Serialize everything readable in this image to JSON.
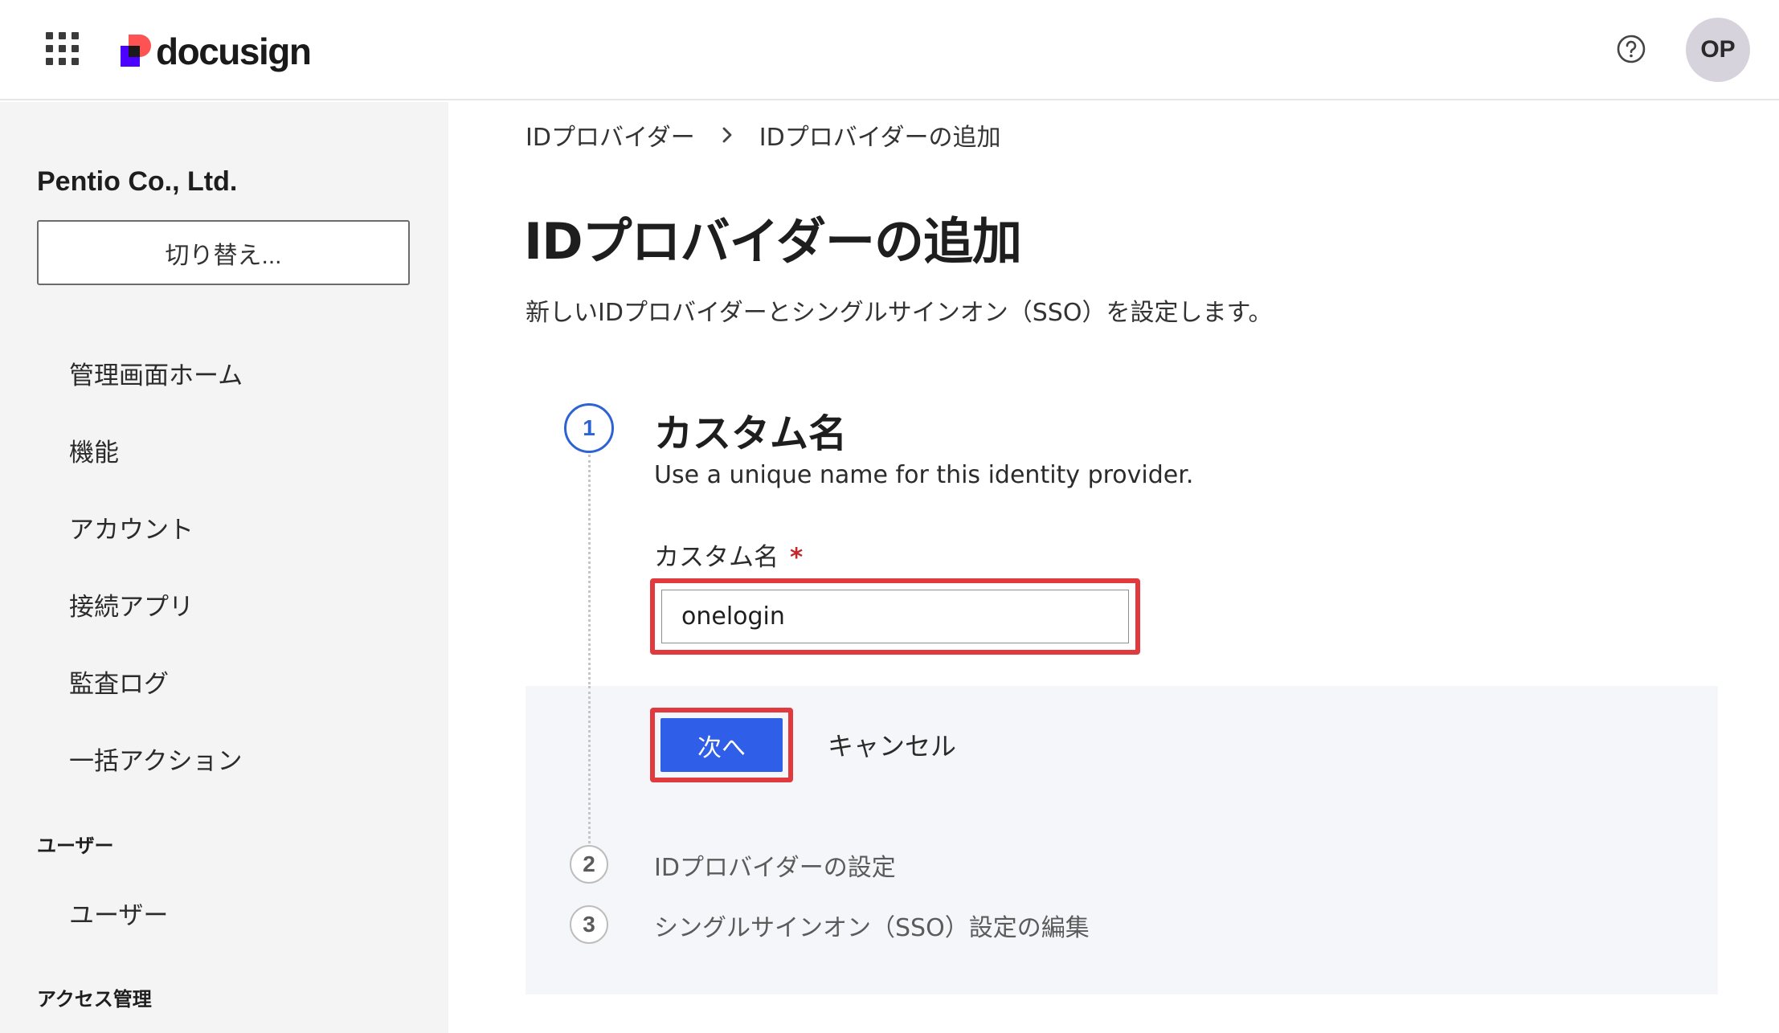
{
  "header": {
    "logo_text": "docusign",
    "avatar_initials": "OP"
  },
  "sidebar": {
    "org_name": "Pentio Co., Ltd.",
    "switch_label": "切り替え...",
    "items": [
      {
        "label": "管理画面ホーム"
      },
      {
        "label": "機能"
      },
      {
        "label": "アカウント"
      },
      {
        "label": "接続アプリ"
      },
      {
        "label": "監査ログ"
      },
      {
        "label": "一括アクション"
      }
    ],
    "section_users": "ユーザー",
    "users_item": "ユーザー",
    "section_access": "アクセス管理"
  },
  "breadcrumb": {
    "parent": "IDプロバイダー",
    "current": "IDプロバイダーの追加"
  },
  "page": {
    "title": "IDプロバイダーの追加",
    "description": "新しいIDプロバイダーとシングルサインオン（SSO）を設定します。"
  },
  "steps": [
    {
      "number": "1",
      "title": "カスタム名",
      "subtitle": "Use a unique name for this identity provider."
    },
    {
      "number": "2",
      "title": "IDプロバイダーの設定"
    },
    {
      "number": "3",
      "title": "シングルサインオン（SSO）設定の編集"
    }
  ],
  "form": {
    "label": "カスタム名",
    "required_mark": "*",
    "value": "onelogin",
    "next_label": "次へ",
    "cancel_label": "キャンセル"
  },
  "colors": {
    "primary": "#2f5fe8",
    "highlight": "#e0393e",
    "active_step": "#2e63d4"
  }
}
